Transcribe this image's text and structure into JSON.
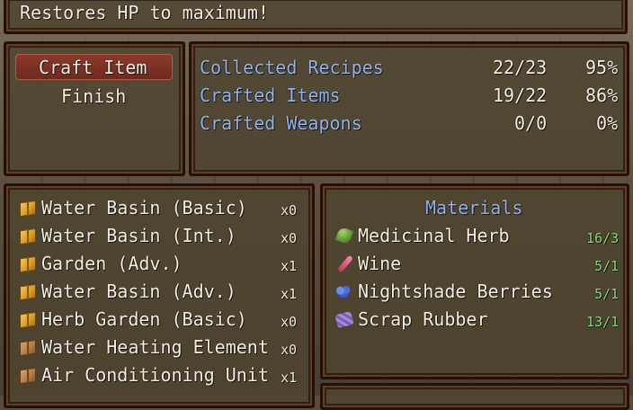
{
  "description_box": {
    "text": "Restores HP to maximum!"
  },
  "command_menu": {
    "items": [
      "Craft Item",
      "Finish"
    ],
    "selected_index": 0
  },
  "stats": [
    {
      "label": "Collected Recipes",
      "count": "22/23",
      "percent": "95%"
    },
    {
      "label": "Crafted Items",
      "count": "19/22",
      "percent": "86%"
    },
    {
      "label": "Crafted Weapons",
      "count": "0/0",
      "percent": "0%"
    }
  ],
  "recipes": [
    {
      "name": "Water Basin (Basic)",
      "qty": "x0",
      "icon": "crate-yellow-icon"
    },
    {
      "name": "Water Basin (Int.)",
      "qty": "x0",
      "icon": "crate-yellow-icon"
    },
    {
      "name": "Garden (Adv.)",
      "qty": "x1",
      "icon": "crate-yellow-icon"
    },
    {
      "name": "Water Basin (Adv.)",
      "qty": "x1",
      "icon": "crate-yellow-icon"
    },
    {
      "name": "Herb Garden (Basic)",
      "qty": "x0",
      "icon": "crate-yellow-icon"
    },
    {
      "name": "Water Heating Element",
      "qty": "x0",
      "icon": "crate-brown-icon"
    },
    {
      "name": "Air Conditioning Unit",
      "qty": "x1",
      "icon": "crate-brown-icon"
    }
  ],
  "materials": {
    "title": "Materials",
    "items": [
      {
        "name": "Medicinal Herb",
        "qty": "16/3",
        "icon": "herb-icon"
      },
      {
        "name": "Wine",
        "qty": "5/1",
        "icon": "wine-bottle-icon"
      },
      {
        "name": "Nightshade Berries",
        "qty": "5/1",
        "icon": "berries-icon"
      },
      {
        "name": "Scrap Rubber",
        "qty": "13/1",
        "icon": "rubber-icon"
      }
    ]
  },
  "colors": {
    "recipe_label": "#8fb4f0",
    "material_qty": "#7de07d",
    "selected_highlight": "#8a3a2c"
  }
}
